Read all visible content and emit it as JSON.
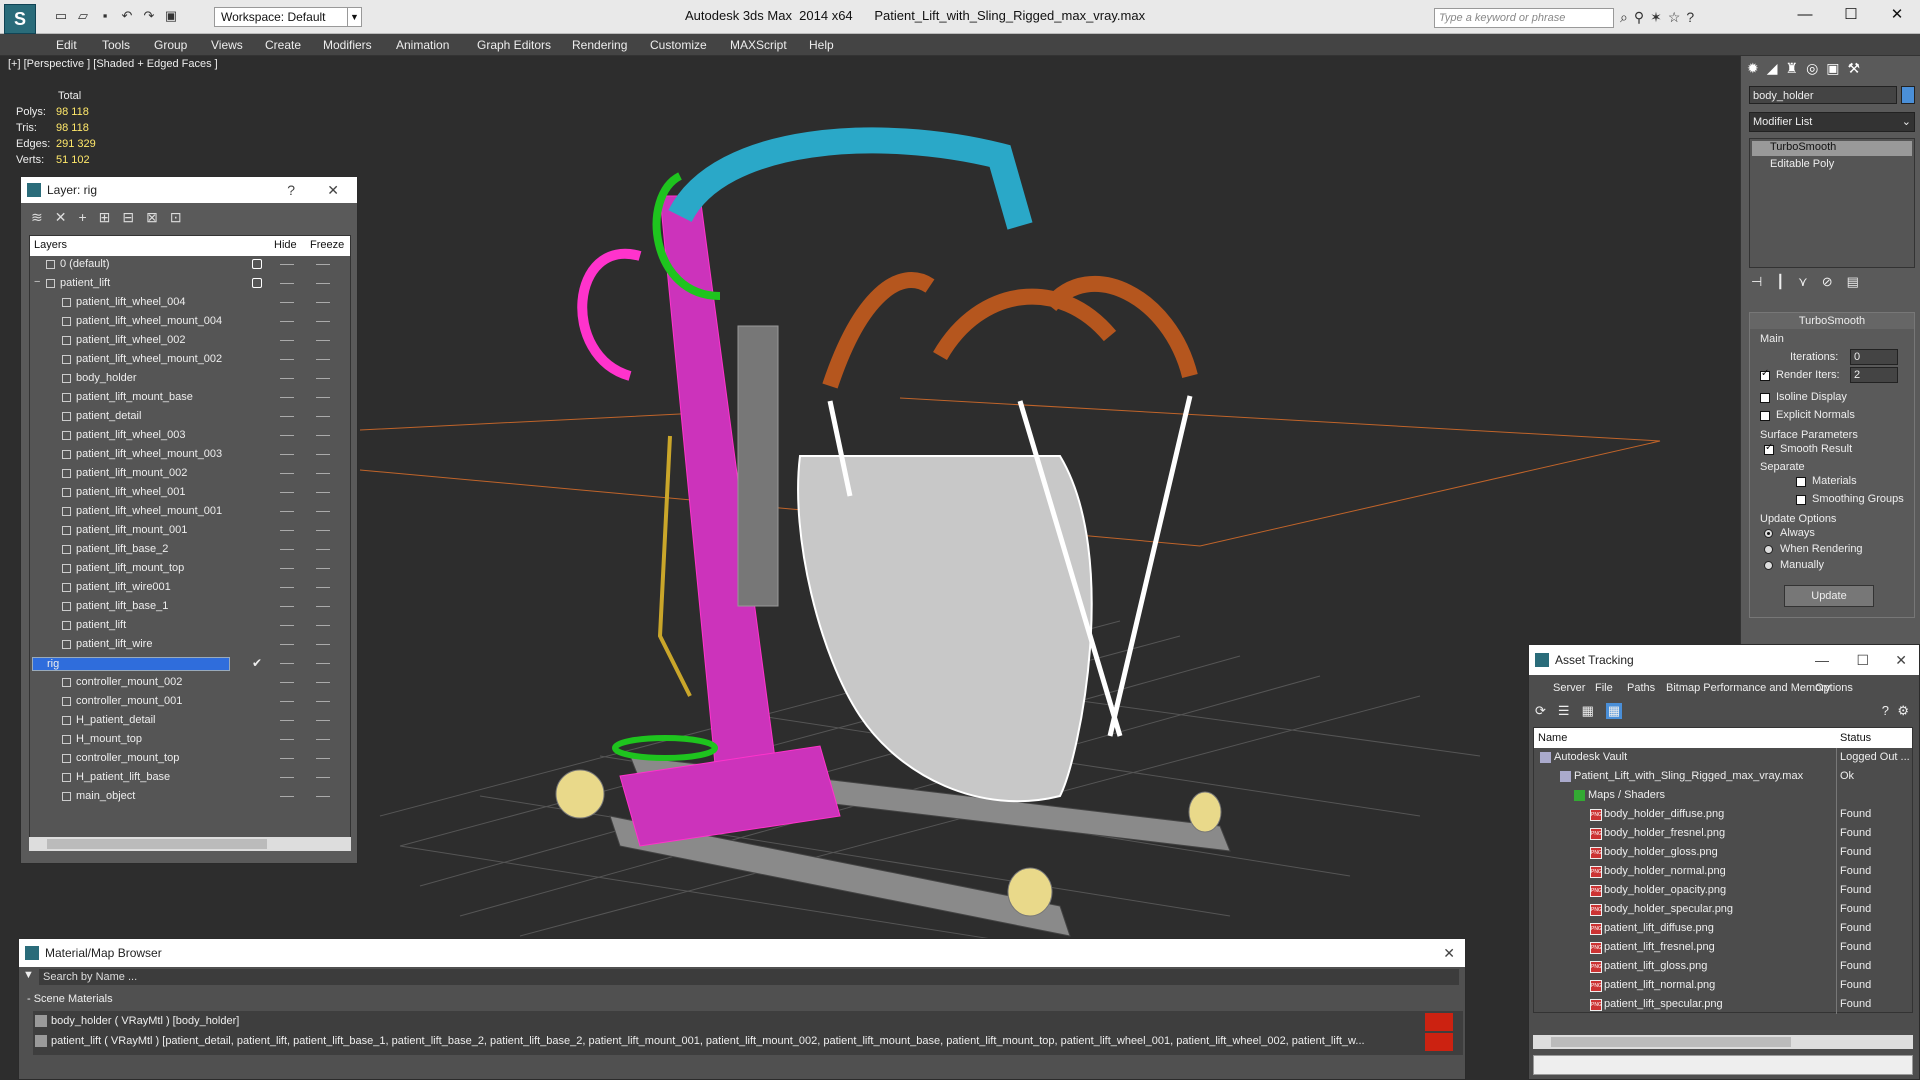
{
  "app": {
    "title": "Autodesk 3ds Max  2014 x64      Patient_Lift_with_Sling_Rigged_max_vray.max",
    "workspace": "Workspace: Default",
    "search_placeholder": "Type a keyword or phrase"
  },
  "menu": [
    "Edit",
    "Tools",
    "Group",
    "Views",
    "Create",
    "Modifiers",
    "Animation",
    "Graph Editors",
    "Rendering",
    "Customize",
    "MAXScript",
    "Help"
  ],
  "viewport": {
    "label": "[+] [Perspective ] [Shaded + Edged Faces ]",
    "stats": {
      "total_label": "Total",
      "rows": [
        {
          "label": "Polys:",
          "value": "98 118"
        },
        {
          "label": "Tris:",
          "value": "98 118"
        },
        {
          "label": "Edges:",
          "value": "291 329"
        },
        {
          "label": "Verts:",
          "value": "51 102"
        }
      ]
    }
  },
  "layer_panel": {
    "title": "Layer: rig",
    "help": "?",
    "close": "✕",
    "col_layers": "Layers",
    "col_hide": "Hide",
    "col_freeze": "Freeze",
    "rows": [
      {
        "name": "0 (default)",
        "level": 0,
        "type": "layer",
        "box": true
      },
      {
        "name": "patient_lift",
        "level": 0,
        "type": "layer",
        "box": true,
        "expand": "−"
      },
      {
        "name": "patient_lift_wheel_004",
        "level": 1,
        "type": "obj"
      },
      {
        "name": "patient_lift_wheel_mount_004",
        "level": 1,
        "type": "obj"
      },
      {
        "name": "patient_lift_wheel_002",
        "level": 1,
        "type": "obj"
      },
      {
        "name": "patient_lift_wheel_mount_002",
        "level": 1,
        "type": "obj"
      },
      {
        "name": "body_holder",
        "level": 1,
        "type": "obj"
      },
      {
        "name": "patient_lift_mount_base",
        "level": 1,
        "type": "obj"
      },
      {
        "name": "patient_detail",
        "level": 1,
        "type": "obj"
      },
      {
        "name": "patient_lift_wheel_003",
        "level": 1,
        "type": "obj"
      },
      {
        "name": "patient_lift_wheel_mount_003",
        "level": 1,
        "type": "obj"
      },
      {
        "name": "patient_lift_mount_002",
        "level": 1,
        "type": "obj"
      },
      {
        "name": "patient_lift_wheel_001",
        "level": 1,
        "type": "obj"
      },
      {
        "name": "patient_lift_wheel_mount_001",
        "level": 1,
        "type": "obj"
      },
      {
        "name": "patient_lift_mount_001",
        "level": 1,
        "type": "obj"
      },
      {
        "name": "patient_lift_base_2",
        "level": 1,
        "type": "obj"
      },
      {
        "name": "patient_lift_mount_top",
        "level": 1,
        "type": "obj"
      },
      {
        "name": "patient_lift_wire001",
        "level": 1,
        "type": "obj"
      },
      {
        "name": "patient_lift_base_1",
        "level": 1,
        "type": "obj"
      },
      {
        "name": "patient_lift",
        "level": 1,
        "type": "obj"
      },
      {
        "name": "patient_lift_wire",
        "level": 1,
        "type": "obj"
      },
      {
        "name": "rig",
        "level": 0,
        "type": "layer",
        "selected": true,
        "check": true,
        "expand": "−"
      },
      {
        "name": "controller_mount_002",
        "level": 1,
        "type": "obj"
      },
      {
        "name": "controller_mount_001",
        "level": 1,
        "type": "obj"
      },
      {
        "name": "H_patient_detail",
        "level": 1,
        "type": "obj"
      },
      {
        "name": "H_mount_top",
        "level": 1,
        "type": "obj"
      },
      {
        "name": "controller_mount_top",
        "level": 1,
        "type": "obj"
      },
      {
        "name": "H_patient_lift_base",
        "level": 1,
        "type": "obj"
      },
      {
        "name": "main_object",
        "level": 1,
        "type": "obj"
      }
    ]
  },
  "command_panel": {
    "object_name": "body_holder",
    "modifier_list": "Modifier List",
    "stack": [
      "TurboSmooth",
      "Editable Poly"
    ],
    "turbosmooth": {
      "title": "TurboSmooth",
      "main": "Main",
      "iterations_label": "Iterations:",
      "iterations": "0",
      "render_iters_label": "Render Iters:",
      "render_iters": "2",
      "isoline": "Isoline Display",
      "explicit_normals": "Explicit Normals",
      "surface_params": "Surface Parameters",
      "smooth_result": "Smooth Result",
      "separate": "Separate",
      "materials": "Materials",
      "smoothing_groups": "Smoothing Groups",
      "update_options": "Update Options",
      "always": "Always",
      "when_rendering": "When Rendering",
      "manually": "Manually",
      "update_btn": "Update"
    }
  },
  "asset_tracking": {
    "title": "Asset Tracking",
    "menu": [
      "Server",
      "File",
      "Paths",
      "Bitmap Performance and Memory",
      "Options"
    ],
    "col_name": "Name",
    "col_status": "Status",
    "rows": [
      {
        "name": "Autodesk Vault",
        "status": "Logged Out ...",
        "indent": 0,
        "icon": "vault"
      },
      {
        "name": "Patient_Lift_with_Sling_Rigged_max_vray.max",
        "status": "Ok",
        "indent": 1,
        "icon": "max"
      },
      {
        "name": "Maps / Shaders",
        "status": "",
        "indent": 2,
        "icon": "maps"
      },
      {
        "name": "body_holder_diffuse.png",
        "status": "Found",
        "indent": 3,
        "icon": "png"
      },
      {
        "name": "body_holder_fresnel.png",
        "status": "Found",
        "indent": 3,
        "icon": "png"
      },
      {
        "name": "body_holder_gloss.png",
        "status": "Found",
        "indent": 3,
        "icon": "png"
      },
      {
        "name": "body_holder_normal.png",
        "status": "Found",
        "indent": 3,
        "icon": "png"
      },
      {
        "name": "body_holder_opacity.png",
        "status": "Found",
        "indent": 3,
        "icon": "png"
      },
      {
        "name": "body_holder_specular.png",
        "status": "Found",
        "indent": 3,
        "icon": "png"
      },
      {
        "name": "patient_lift_diffuse.png",
        "status": "Found",
        "indent": 3,
        "icon": "png"
      },
      {
        "name": "patient_lift_fresnel.png",
        "status": "Found",
        "indent": 3,
        "icon": "png"
      },
      {
        "name": "patient_lift_gloss.png",
        "status": "Found",
        "indent": 3,
        "icon": "png"
      },
      {
        "name": "patient_lift_normal.png",
        "status": "Found",
        "indent": 3,
        "icon": "png"
      },
      {
        "name": "patient_lift_specular.png",
        "status": "Found",
        "indent": 3,
        "icon": "png"
      }
    ]
  },
  "material_browser": {
    "title": "Material/Map Browser",
    "search_placeholder": "Search by Name ...",
    "group": "- Scene Materials",
    "materials": [
      "body_holder ( VRayMtl ) [body_holder]",
      "patient_lift ( VRayMtl ) [patient_detail, patient_lift, patient_lift_base_1, patient_lift_base_2, patient_lift_base_2, patient_lift_mount_001, patient_lift_mount_002, patient_lift_mount_base, patient_lift_mount_top, patient_lift_wheel_001, patient_lift_wheel_002, patient_lift_w..."
    ]
  },
  "colors": {
    "selection": "#2f6ddc",
    "stats": "#ffe86a",
    "sling": "#ffffff",
    "frame": "#ff33cc",
    "boom": "#2aa8c8",
    "handle": "#b5561e",
    "base": "#8a8a8a"
  }
}
